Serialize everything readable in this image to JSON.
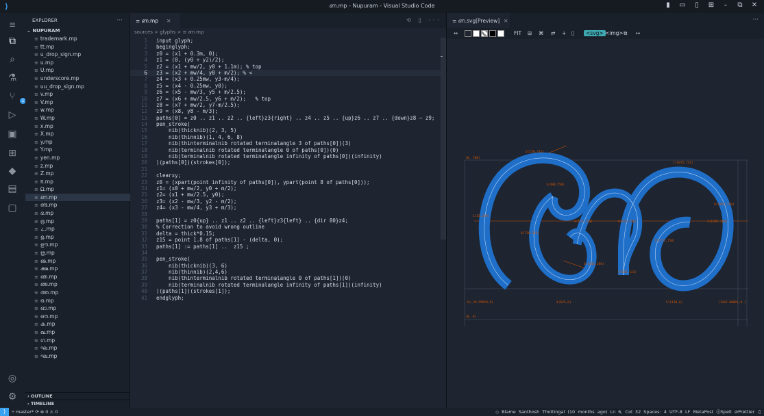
{
  "window": {
    "title": "ണ.mp - Nupuram - Visual Studio Code"
  },
  "sidebar": {
    "header": "EXPLORER",
    "more": "···",
    "root_folder": "NUPURAM",
    "files": [
      "trademark.mp",
      "tt.mp",
      "u_drop_sign.mp",
      "u.mp",
      "U.mp",
      "underscore.mp",
      "uu_drop_sign.mp",
      "v.mp",
      "V.mp",
      "w.mp",
      "W.mp",
      "x.mp",
      "X.mp",
      "y.mp",
      "Y.mp",
      "yen.mp",
      "z.mp",
      "Z.mp",
      "π.mp",
      "Ω.mp",
      "ണ.mp",
      "ണ്ട.mp",
      "ഭ.mp",
      "ഭ്ര.mp",
      "ഺ.mp",
      "ഉ.mp",
      "ഊ.mp",
      "ഋ.mp",
      "ഌ.mp",
      "ക്ഷ.mp",
      "ഞ.mp",
      "ങ്ങ.mp",
      "ത്ത.mp",
      "ഒ.mp",
      "ഓ.mp",
      "ഔ.mp",
      "ക.mp",
      "ഖ.mp",
      "ഗ.mp",
      "ഘ.mp",
      "ഘ.mp"
    ],
    "selected_file": "ണ.mp",
    "sections": {
      "outline": "OUTLINE",
      "timeline": "TIMELINE"
    }
  },
  "editor": {
    "tab_label": "ണ.mp",
    "breadcrumb": "sources  >  glyphs  >  ≡ ണ.mp",
    "current_line": 6,
    "lines": [
      "input glyph;",
      "beginglyph;",
      "z0 = (x1 + 0.3m, 0);",
      "z1 = (0, (y0 + y2)/2);",
      "z2 = (x1 + mw/2, y0 + 1.1m); % top",
      "z3 = (x2 + mw/4, y0 + m/2); % <",
      "z4 = (x3 + 0.25mw, y3-m/4);",
      "z5 = (x4 - 0.25mw, y0);",
      "z6 = (x5 - mw/3, y5 + m/2.5);",
      "z7 = (x6 + mw/2.5, y6 + m/2);   % top",
      "z8 = (x7 + mw/2, y7-m/2.5);",
      "z9 = (x8, y8 - m/3);",
      "paths[0] = z0 .. z1 .. z2 .. {left}z3{right} .. z4 .. z5 .. {up}z6 .. z7 .. {down}z8 — z9;",
      "pen_stroke(",
      "    nib(thicknib)(2, 3, 5)",
      "    nib(thinnib)(1, 4, 6, 8)",
      "    nib(thinterminalnib rotated terminalangle 3 of paths[0])(3)",
      "    nib(terminalnib rotated terminalangle 0 of paths[0])(0)",
      "    nib(terminalnib rotated terminalangle infinity of paths[0])(infinity)",
      ")(paths[0])(strokes[0]);",
      "",
      "clearxy;",
      "z0 = (xpart(point infinity of paths[0]), ypart(point 8 of paths[0]));",
      "z1= (x0 + mw/2, y0 + m/2);",
      "z2= (x1 + mw/2.5, y0);",
      "z3= (x2 - mw/3, y2 - m/2);",
      "z4= (x3 - mw/4, y3 + m/3);",
      "",
      "paths[1] = z0{up} .. z1 .. z2 .. {left}z3{left} .. {dir 80}z4;",
      "% Correction to avoid wrong outline",
      "delta = thick*0.15;",
      "z15 = point 1.8 of paths[1] - (delta, 0);",
      "paths[1] := paths[1] ..  z15 ;",
      "",
      "pen_stroke(",
      "    nib(thicknib)(3, 6)",
      "    nib(thinnib)(2,4,6)",
      "    nib(thinterminalnib rotated terminalangle 0 of paths[1])(0)",
      "    nib(terminalnib rotated terminalangle infinity of paths[1])(infinity)",
      ")(paths[1])(strokes[1]);",
      "endglyph;"
    ]
  },
  "preview": {
    "tab_label": "ണ.svg[Preview]",
    "toolbar": {
      "fit": "FIT",
      "svg": "<svg>",
      "img": "<img>"
    },
    "labels": {
      "origin_top": "(0, 700)",
      "origin_bottom": "(0, 0)",
      "p1": "2(250,741)",
      "p2": "7(1075,741)",
      "p3": "1(35,250)",
      "p4": "3(480,550)",
      "p5": "4(555,350)",
      "p6": "6(625,250)",
      "p7": "5(535,123)",
      "p8": "0(1262,250)",
      "p9": "0(1262,0)",
      "p10": "8(710,350)",
      "p11": "6(1242,200)",
      "p12": "6(1262,350)",
      "p13": "7(1152,250)",
      "p14": "5(1138,6)",
      "p15": "(1462.00001,0 )",
      "p16": "0(-38.99920,0)",
      "p17": "4(625,0)",
      "p18": "2(1302,200)"
    },
    "glyph_color": "#1f6fc8",
    "guide_color": "#d35400"
  },
  "statusbar": {
    "branch": "master*",
    "problems": "⊗ 0 ⚠ 0",
    "blame": "◇ Blame Santhosh Thottingal (10 months ago)",
    "position": "Ln 6, Col 32",
    "spaces": "Spaces: 4",
    "encoding": "UTF-8",
    "eol": "LF",
    "language": "MetaPost",
    "spell": "Spell",
    "prettier": "Prettier"
  }
}
